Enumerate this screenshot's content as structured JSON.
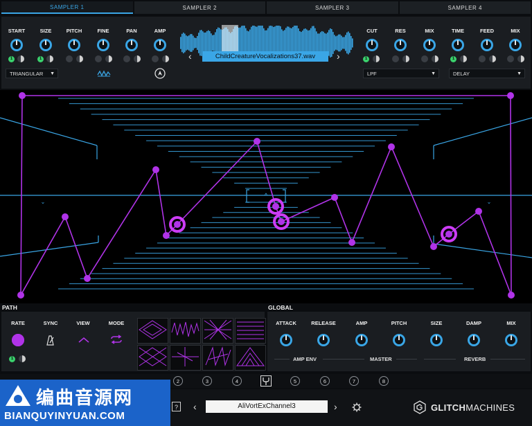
{
  "tabs": [
    {
      "label": "SAMPLER 1",
      "active": true
    },
    {
      "label": "SAMPLER 2",
      "active": false
    },
    {
      "label": "SAMPLER 3",
      "active": false
    },
    {
      "label": "SAMPLER 4",
      "active": false
    }
  ],
  "sampler": {
    "knobs_left": [
      "START",
      "SIZE",
      "PITCH",
      "FINE",
      "PAN",
      "AMP"
    ],
    "knobs_right": [
      "CUT",
      "RES",
      "MIX",
      "TIME",
      "FEED",
      "MIX"
    ],
    "mod_badge": "1",
    "lfo_shape": "TRIANGULAR",
    "filter_type": "LPF",
    "fx_type": "DELAY",
    "file_name": "ChildCreatureVocalizations37.wav"
  },
  "path": {
    "section_label": "PATH",
    "controls": [
      "RATE",
      "SYNC",
      "VIEW",
      "MODE"
    ],
    "mod_badge": "1"
  },
  "global": {
    "section_label": "GLOBAL",
    "knobs": [
      "ATTACK",
      "RELEASE",
      "AMP",
      "PITCH",
      "SIZE",
      "DAMP",
      "MIX"
    ],
    "groups": [
      "AMP ENV",
      "MASTER",
      "REVERB"
    ]
  },
  "slots": [
    "2",
    "3",
    "4",
    "5",
    "6",
    "7",
    "8"
  ],
  "footer": {
    "help_glyph": "?",
    "preset_name": "AliVortExChannel3",
    "brand_bold": "GLITCH",
    "brand_light": "MACHINES"
  },
  "watermark": {
    "text": "编曲音源网",
    "url": "BIANQUYINYUAN.COM"
  },
  "colors": {
    "accent": "#3aa6e6",
    "path": "#b033e8",
    "mod": "#3ad06c"
  }
}
